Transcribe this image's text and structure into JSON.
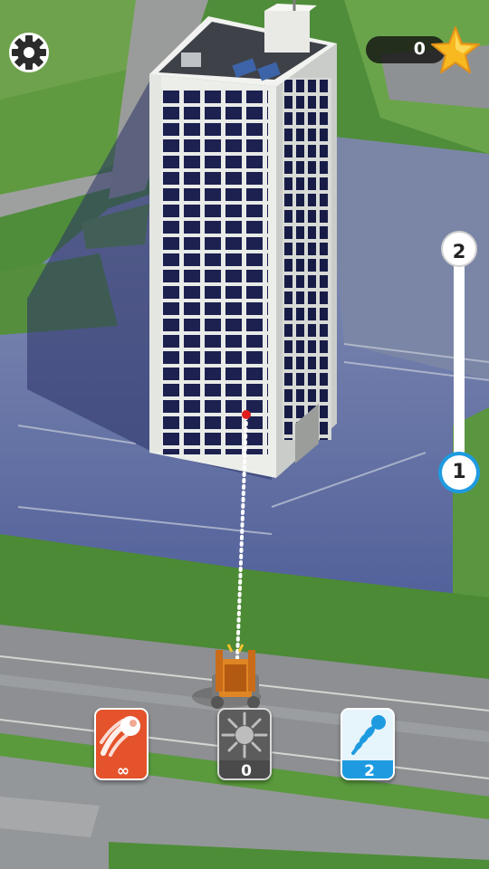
{
  "hud": {
    "score": "0",
    "level_current": "1",
    "level_next": "2",
    "level_progress": 0.0
  },
  "powerups": [
    {
      "name": "fireball",
      "count": "∞",
      "color": "#e4532b"
    },
    {
      "name": "bomb",
      "count": "0",
      "color": "#5c5c5c"
    },
    {
      "name": "drill",
      "count": "2",
      "color": "#1e9be0"
    }
  ],
  "icons": {
    "settings": "gear-icon",
    "score": "star-icon",
    "fireball": "fireball-icon",
    "bomb": "explosion-icon",
    "drill": "drill-icon"
  }
}
